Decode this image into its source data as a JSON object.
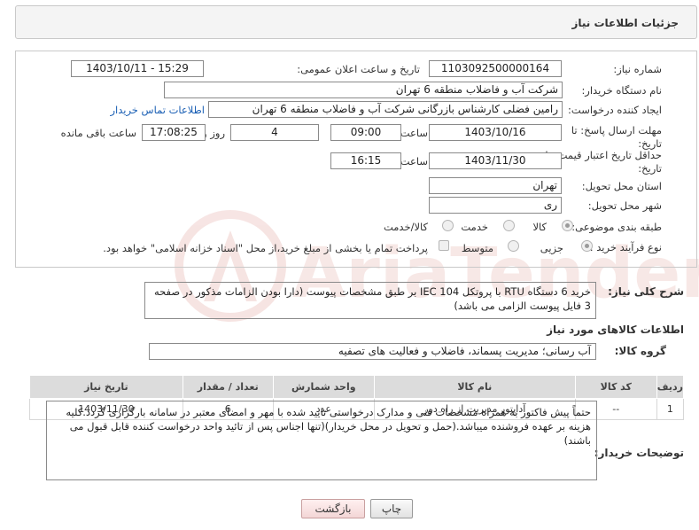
{
  "header": {
    "title": "جزئیات اطلاعات نیاز"
  },
  "form": {
    "need_number_label": "شماره نیاز:",
    "need_number": "1103092500000164",
    "announce_label": "تاریخ و ساعت اعلان عمومی:",
    "announce_value": "1403/10/11 - 15:29",
    "buyer_label": "نام دستگاه خریدار:",
    "buyer_value": "شرکت آب و فاضلاب منطقه 6 تهران",
    "creator_label": "ایجاد کننده درخواست:",
    "creator_value": "رامین  فضلی کارشناس بازرگانی شرکت آب و فاضلاب منطقه 6 تهران",
    "contact_link": "اطلاعات تماس خریدار",
    "deadline_label": "مهلت ارسال پاسخ: تا تاریخ:",
    "deadline_date": "1403/10/16",
    "time_label": "ساعت",
    "deadline_time": "09:00",
    "days_value": "4",
    "days_label": "روز و",
    "remaining_time": "17:08:25",
    "remaining_label": "ساعت باقی مانده",
    "validity_label": "حداقل تاریخ اعتبار قیمت: تا تاریخ:",
    "validity_date": "1403/11/30",
    "validity_time": "16:15",
    "province_label": "استان محل تحویل:",
    "province_value": "تهران",
    "city_label": "شهر محل تحویل:",
    "city_value": "ری",
    "category_label": "طبقه بندی موضوعی:",
    "category_options": [
      "کالا",
      "خدمت",
      "کالا/خدمت"
    ],
    "process_label": "نوع فرآیند خرید :",
    "process_options": [
      "جزیی",
      "متوسط"
    ],
    "payment_note": "پرداخت تمام یا بخشی از مبلغ خرید،از محل \"اسناد خزانه اسلامی\" خواهد بود."
  },
  "description": {
    "label": "شرح کلی نیاز:",
    "text": "خرید 6 دستگاه RTU با پروتکل IEC 104 بر طبق مشخصات پیوست (دارا بودن الزامات مذکور در صفحه 3 فایل پیوست الزامی می باشد)"
  },
  "goods": {
    "section_title": "اطلاعات کالاهای مورد نیاز",
    "group_label": "گروه کالا:",
    "group_value": "آب رسانی؛ مدیریت پسماند، فاضلاب و فعالیت های تصفیه",
    "columns": [
      "ردیف",
      "کد کالا",
      "نام کالا",
      "واحد شمارش",
      "تعداد / مقدار",
      "تاریخ نیاز"
    ],
    "rows": [
      [
        "1",
        "--",
        "آداپتور مدیریت از راه دور",
        "عدد",
        "6",
        "1403/11/30"
      ]
    ]
  },
  "notes": {
    "label": "توضیحات خریدار:",
    "text": "حتماً پیش فاکتور به همراه مشخصات فنی و مدارک درخواستی تایید شده با مهر و امضای معتبر در سامانه بارگزاری گردد.کلیه هزینه بر عهده فروشنده میباشد.(حمل و تحویل در محل خریدار)(تنها اجناس پس از تائید واحد درخواست کننده قابل قبول می باشند)"
  },
  "buttons": {
    "print": "چاپ",
    "back": "بازگشت"
  },
  "watermark": {
    "text": "AriaTender.neT"
  }
}
